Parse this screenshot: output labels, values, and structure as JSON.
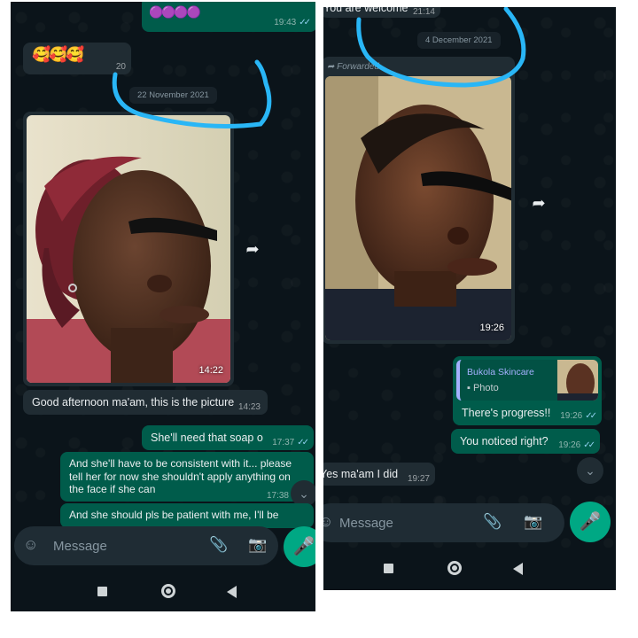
{
  "left": {
    "top_bubble_time": "19:43",
    "top_bubble_emojis": "🟣🟣🟣🟣",
    "emoji_bubble": {
      "emojis": "🥰🥰🥰",
      "time": "20"
    },
    "date_chip": "22 November 2021",
    "photo_time": "14:22",
    "messages": [
      {
        "text": "Good afternoon ma'am, this is the picture",
        "time": "14:23"
      },
      {
        "text": "She'll need that soap o",
        "time": "17:37"
      },
      {
        "text": "And she'll have to be consistent with it... please tell her for now she shouldn't apply anything on the face if she can",
        "time": "17:38"
      },
      {
        "text": "And she should pls be patient with me, I'll be",
        "time": ""
      }
    ],
    "input_placeholder": "Message"
  },
  "right": {
    "top_bubble_text": "You are welcome",
    "top_bubble_time": "21:14",
    "date_chip": "4 December 2021",
    "forwarded_label": "Forwarded",
    "photo_time": "19:26",
    "reply_quote": {
      "author": "Bukola Skincare",
      "label": "Photo"
    },
    "messages": [
      {
        "text": "There's progress!!",
        "time": "19:26"
      },
      {
        "text": "You noticed right?",
        "time": "19:26"
      },
      {
        "text": "Yes ma'am I did",
        "time": "19:27"
      }
    ],
    "input_placeholder": "Message"
  },
  "colors": {
    "annotation": "#29b6f6",
    "outgoing": "#005c4b",
    "incoming": "#202c33",
    "accent": "#00a884"
  },
  "icons": [
    "emoji-icon",
    "attach-icon",
    "camera-icon",
    "mic-icon",
    "forward-icon",
    "double-check-icon",
    "chevron-down-icon",
    "nav-recent-icon",
    "nav-home-icon",
    "nav-back-icon"
  ]
}
